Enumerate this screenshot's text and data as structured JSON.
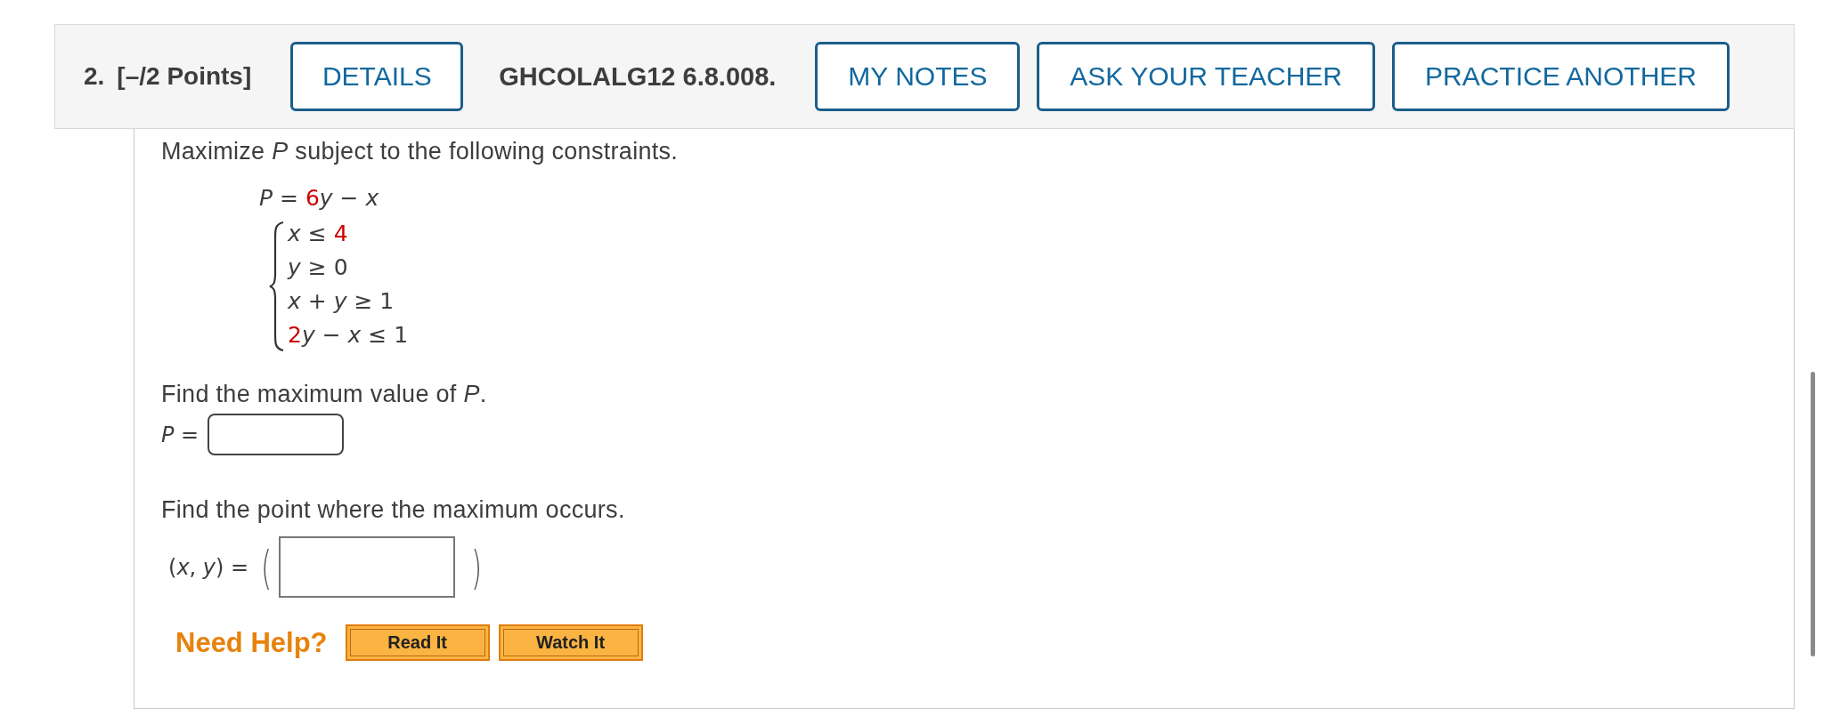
{
  "header": {
    "number": "2.",
    "points": "[–/2 Points]",
    "code": "GHCOLALG12 6.8.008.",
    "buttons": [
      {
        "label": "DETAILS",
        "kind": "details"
      },
      {
        "label": "MY NOTES",
        "kind": "action"
      },
      {
        "label": "ASK YOUR TEACHER",
        "kind": "action"
      },
      {
        "label": "PRACTICE ANOTHER",
        "kind": "action"
      }
    ]
  },
  "question": {
    "intro": "Maximize *P* subject to the following constraints.",
    "objective": [
      {
        "text": "*P* = ",
        "highlight": false
      },
      {
        "text": "6",
        "highlight": true
      },
      {
        "text": "*y* − *x*",
        "highlight": false
      }
    ],
    "constraints": [
      [
        {
          "text": "*x* ≤ ",
          "highlight": false
        },
        {
          "text": "4",
          "highlight": true
        }
      ],
      [
        {
          "text": "*y* ≥ 0",
          "highlight": false
        }
      ],
      [
        {
          "text": "*x* + *y* ≥ 1",
          "highlight": false
        }
      ],
      [
        {
          "text": "2",
          "highlight": true
        },
        {
          "text": "*y* − *x* ≤ 1",
          "highlight": false
        }
      ]
    ],
    "part1": {
      "prompt": "Find the maximum value of *P*.",
      "label": "*P* ="
    },
    "part2": {
      "prompt": "Find the point where the maximum occurs.",
      "label": "(*x*, *y*) =",
      "open_paren": "(",
      "close_paren": ")"
    }
  },
  "help": {
    "label": "Need Help?",
    "buttons": [
      "Read It",
      "Watch It"
    ]
  }
}
